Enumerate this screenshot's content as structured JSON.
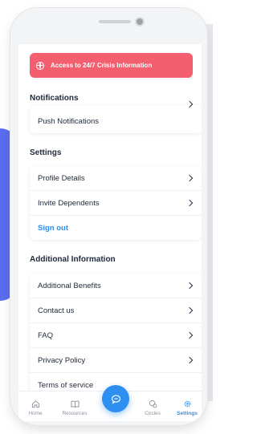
{
  "banner": {
    "label": "Access to 24/7 Crisis Information",
    "icon": "globe-icon",
    "color": "#f35f6f"
  },
  "notifications": {
    "title": "Notifications",
    "items": [
      {
        "label": "Push Notifications"
      }
    ]
  },
  "settings": {
    "title": "Settings",
    "items": [
      {
        "label": "Profile Details"
      },
      {
        "label": "Invite Dependents"
      }
    ],
    "sign_out": "Sign out"
  },
  "additional": {
    "title": "Additional Information",
    "items": [
      {
        "label": "Additional Benefits"
      },
      {
        "label": "Contact us"
      },
      {
        "label": "FAQ"
      },
      {
        "label": "Privacy Policy"
      },
      {
        "label": "Terms of service"
      }
    ]
  },
  "tabbar": {
    "tabs": [
      {
        "label": "Home",
        "icon": "home-icon",
        "active": false
      },
      {
        "label": "Resources",
        "icon": "book-icon",
        "active": false
      },
      {
        "label": "Circles",
        "icon": "circles-icon",
        "active": false
      },
      {
        "label": "Settings",
        "icon": "gear-icon",
        "active": true
      }
    ],
    "fab_icon": "chat-icon"
  },
  "colors": {
    "accent": "#2f8ff0",
    "banner": "#f35f6f",
    "text": "#1f2a3a"
  }
}
